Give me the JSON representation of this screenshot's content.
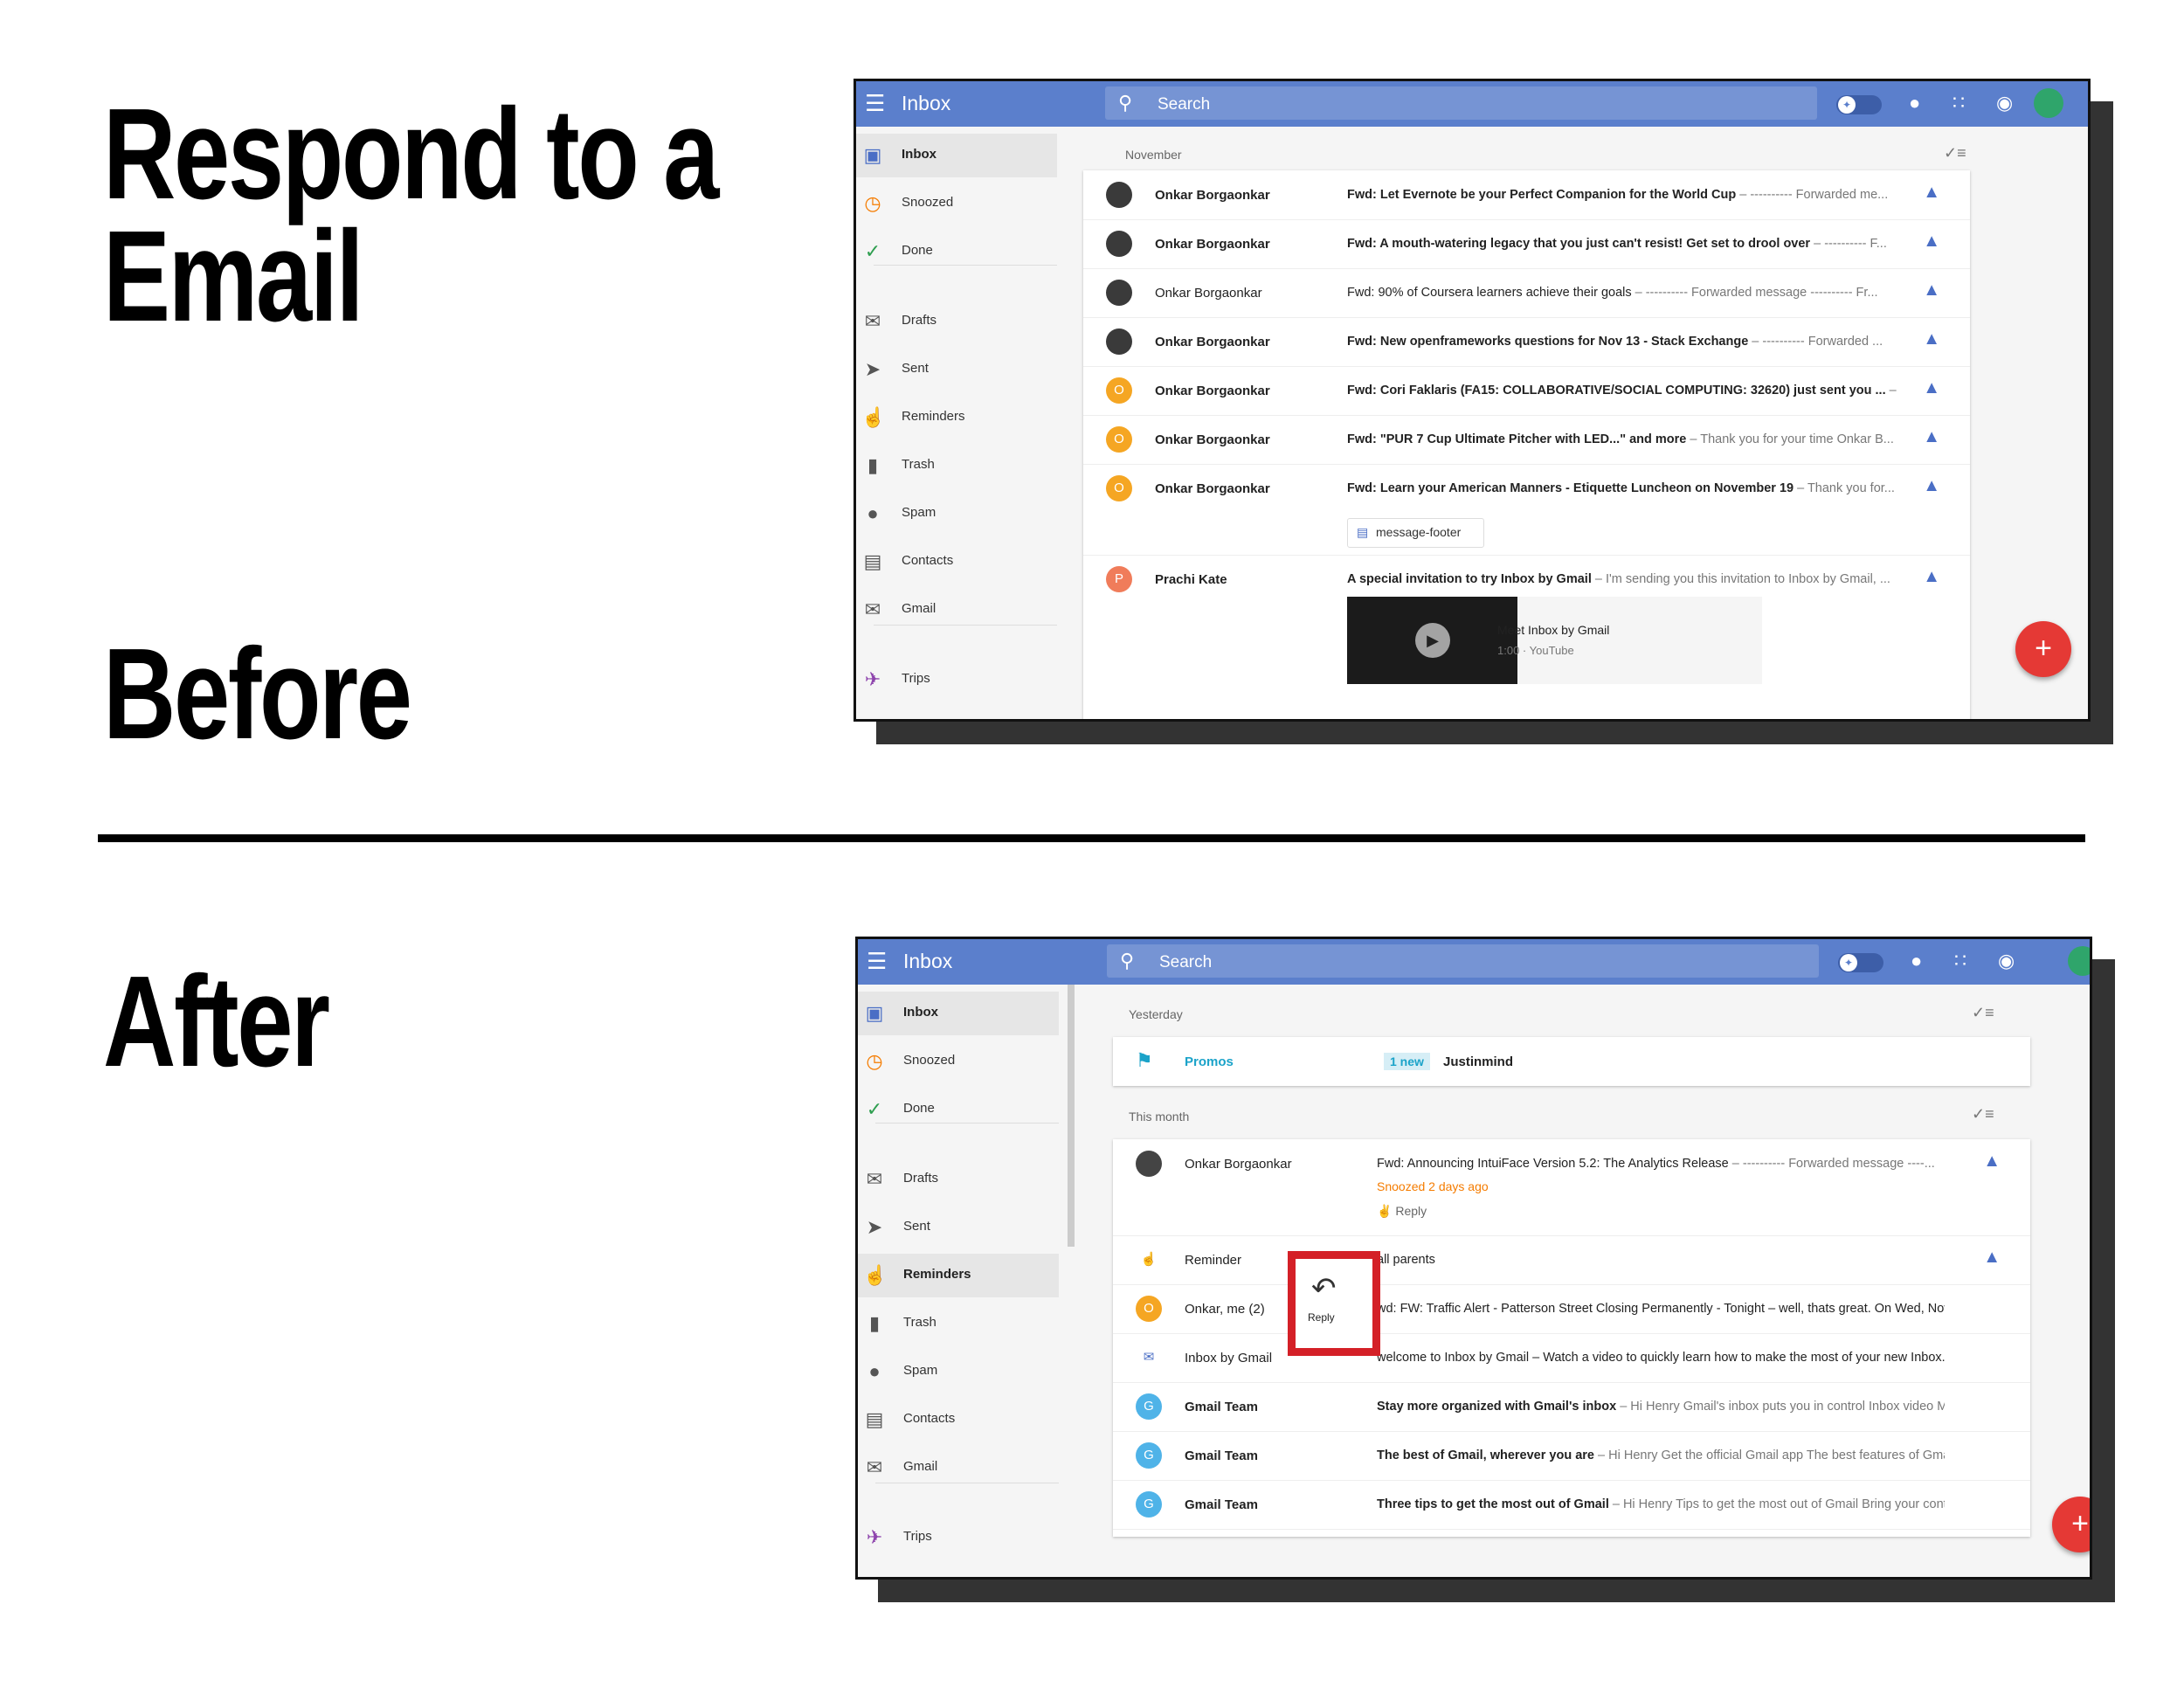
{
  "headings": {
    "title_line1": "Respond to a",
    "title_line2": "Email",
    "before": "Before",
    "after": "After"
  },
  "before_screen": {
    "app_title": "Inbox",
    "search_placeholder": "Search",
    "sidebar": [
      {
        "label": "Inbox",
        "icon": "inbox-icon",
        "selected": true
      },
      {
        "label": "Snoozed",
        "icon": "clock-icon"
      },
      {
        "label": "Done",
        "icon": "check-icon"
      },
      {
        "label": "Drafts",
        "icon": "drafts-icon"
      },
      {
        "label": "Sent",
        "icon": "send-icon"
      },
      {
        "label": "Reminders",
        "icon": "reminder-hand-icon"
      },
      {
        "label": "Trash",
        "icon": "trash-icon"
      },
      {
        "label": "Spam",
        "icon": "spam-icon"
      },
      {
        "label": "Contacts",
        "icon": "contacts-icon"
      },
      {
        "label": "Gmail",
        "icon": "gmail-icon"
      },
      {
        "label": "Trips",
        "icon": "plane-icon"
      }
    ],
    "section": "November",
    "emails": [
      {
        "sender": "Onkar Borgaonkar",
        "bold": true,
        "subject": "Fwd: Let Evernote be your Perfect Companion for the World Cup",
        "snippet": " – ---------- Forwarded me..."
      },
      {
        "sender": "Onkar Borgaonkar",
        "bold": true,
        "subject": "Fwd: A mouth-watering legacy that you just can't resist! Get set to drool over",
        "snippet": " – ---------- F..."
      },
      {
        "sender": "Onkar Borgaonkar",
        "bold": false,
        "subject": "Fwd: 90% of Coursera learners achieve their goals",
        "snippet": " – ---------- Forwarded message ---------- Fr..."
      },
      {
        "sender": "Onkar Borgaonkar",
        "bold": true,
        "subject": "Fwd: New openframeworks questions for Nov 13 - Stack Exchange",
        "snippet": " – ---------- Forwarded ..."
      },
      {
        "sender": "Onkar Borgaonkar",
        "bold": true,
        "subject": "Fwd: Cori Faklaris (FA15: COLLABORATIVE/SOCIAL COMPUTING: 32620) just sent you ...",
        "snippet": " –"
      },
      {
        "sender": "Onkar Borgaonkar",
        "bold": true,
        "subject": "Fwd: \"PUR 7 Cup Ultimate Pitcher with LED...\" and more",
        "snippet": " – Thank you for your time Onkar B..."
      },
      {
        "sender": "Onkar Borgaonkar",
        "bold": true,
        "subject": "Fwd: Learn your American Manners - Etiquette Luncheon on November 19",
        "snippet": " – Thank you for..."
      },
      {
        "sender": "Prachi Kate",
        "bold": true,
        "subject": "A special invitation to try Inbox by Gmail",
        "snippet": " – I'm sending you this invitation to Inbox by Gmail, ..."
      }
    ],
    "attachment_chip": "message-footer",
    "video": {
      "title": "Meet Inbox by Gmail",
      "duration": "1:00",
      "source": "YouTube"
    },
    "avatar_letters": {
      "onkar": "O",
      "prachi": "P"
    },
    "fab_label": "+"
  },
  "after_screen": {
    "app_title": "Inbox",
    "search_placeholder": "Search",
    "sidebar": [
      {
        "label": "Inbox",
        "icon": "inbox-icon",
        "selected": true
      },
      {
        "label": "Snoozed",
        "icon": "clock-icon"
      },
      {
        "label": "Done",
        "icon": "check-icon"
      },
      {
        "label": "Drafts",
        "icon": "drafts-icon"
      },
      {
        "label": "Sent",
        "icon": "send-icon"
      },
      {
        "label": "Reminders",
        "icon": "reminder-hand-icon",
        "hover": true
      },
      {
        "label": "Trash",
        "icon": "trash-icon"
      },
      {
        "label": "Spam",
        "icon": "spam-icon"
      },
      {
        "label": "Contacts",
        "icon": "contacts-icon"
      },
      {
        "label": "Gmail",
        "icon": "gmail-icon"
      },
      {
        "label": "Trips",
        "icon": "plane-icon"
      }
    ],
    "section_yesterday": "Yesterday",
    "promos": {
      "label": "Promos",
      "badge": "1 new",
      "sender": "Justinmind"
    },
    "section_month": "This month",
    "snoozed_email": {
      "sender": "Onkar Borgaonkar",
      "subject": "Fwd: Announcing IntuiFace Version 5.2: The Analytics Release",
      "snippet": " – ---------- Forwarded message ----...",
      "snoozed_note": "Snoozed 2 days ago",
      "reply_link": "Reply"
    },
    "emails": [
      {
        "sender": "Reminder",
        "bold": false,
        "subject": "",
        "snippet": "all parents",
        "avatar": "reminder"
      },
      {
        "sender": "Onkar, me (2)",
        "bold": false,
        "subject": "",
        "snippet": "wd: FW: Traffic Alert - Patterson Street Closing Permanently - Tonight – well, thats great. On Wed, Nov ...",
        "avatar": "O"
      },
      {
        "sender": "Inbox by Gmail",
        "bold": false,
        "subject": "",
        "snippet": "welcome to Inbox by Gmail – Watch a video to quickly learn how to make the most of your new Inbox. I...",
        "avatar": "inbox"
      },
      {
        "sender": "Gmail Team",
        "bold": true,
        "subject": "Stay more organized with Gmail's inbox",
        "snippet": " – Hi Henry Gmail's inbox puts you in control Inbox video Me...",
        "avatar": "G"
      },
      {
        "sender": "Gmail Team",
        "bold": true,
        "subject": "The best of Gmail, wherever you are",
        "snippet": " – Hi Henry Get the official Gmail app The best features of Gmail ...",
        "avatar": "G"
      },
      {
        "sender": "Gmail Team",
        "bold": true,
        "subject": "Three tips to get the most out of Gmail",
        "snippet": " – Hi Henry Tips to get the most out of Gmail Bring your conta...",
        "avatar": "G"
      }
    ],
    "reply_popup_label": "Reply",
    "fab_label": "+"
  },
  "colors": {
    "topbar": "#5b7fcc",
    "accent_red": "#d42027",
    "fab": "#e53935",
    "avatar_orange": "#f5a623",
    "avatar_blue": "#4fb3e8",
    "promos_teal": "#1ba3c9",
    "snoozed_orange": "#f57c00"
  }
}
